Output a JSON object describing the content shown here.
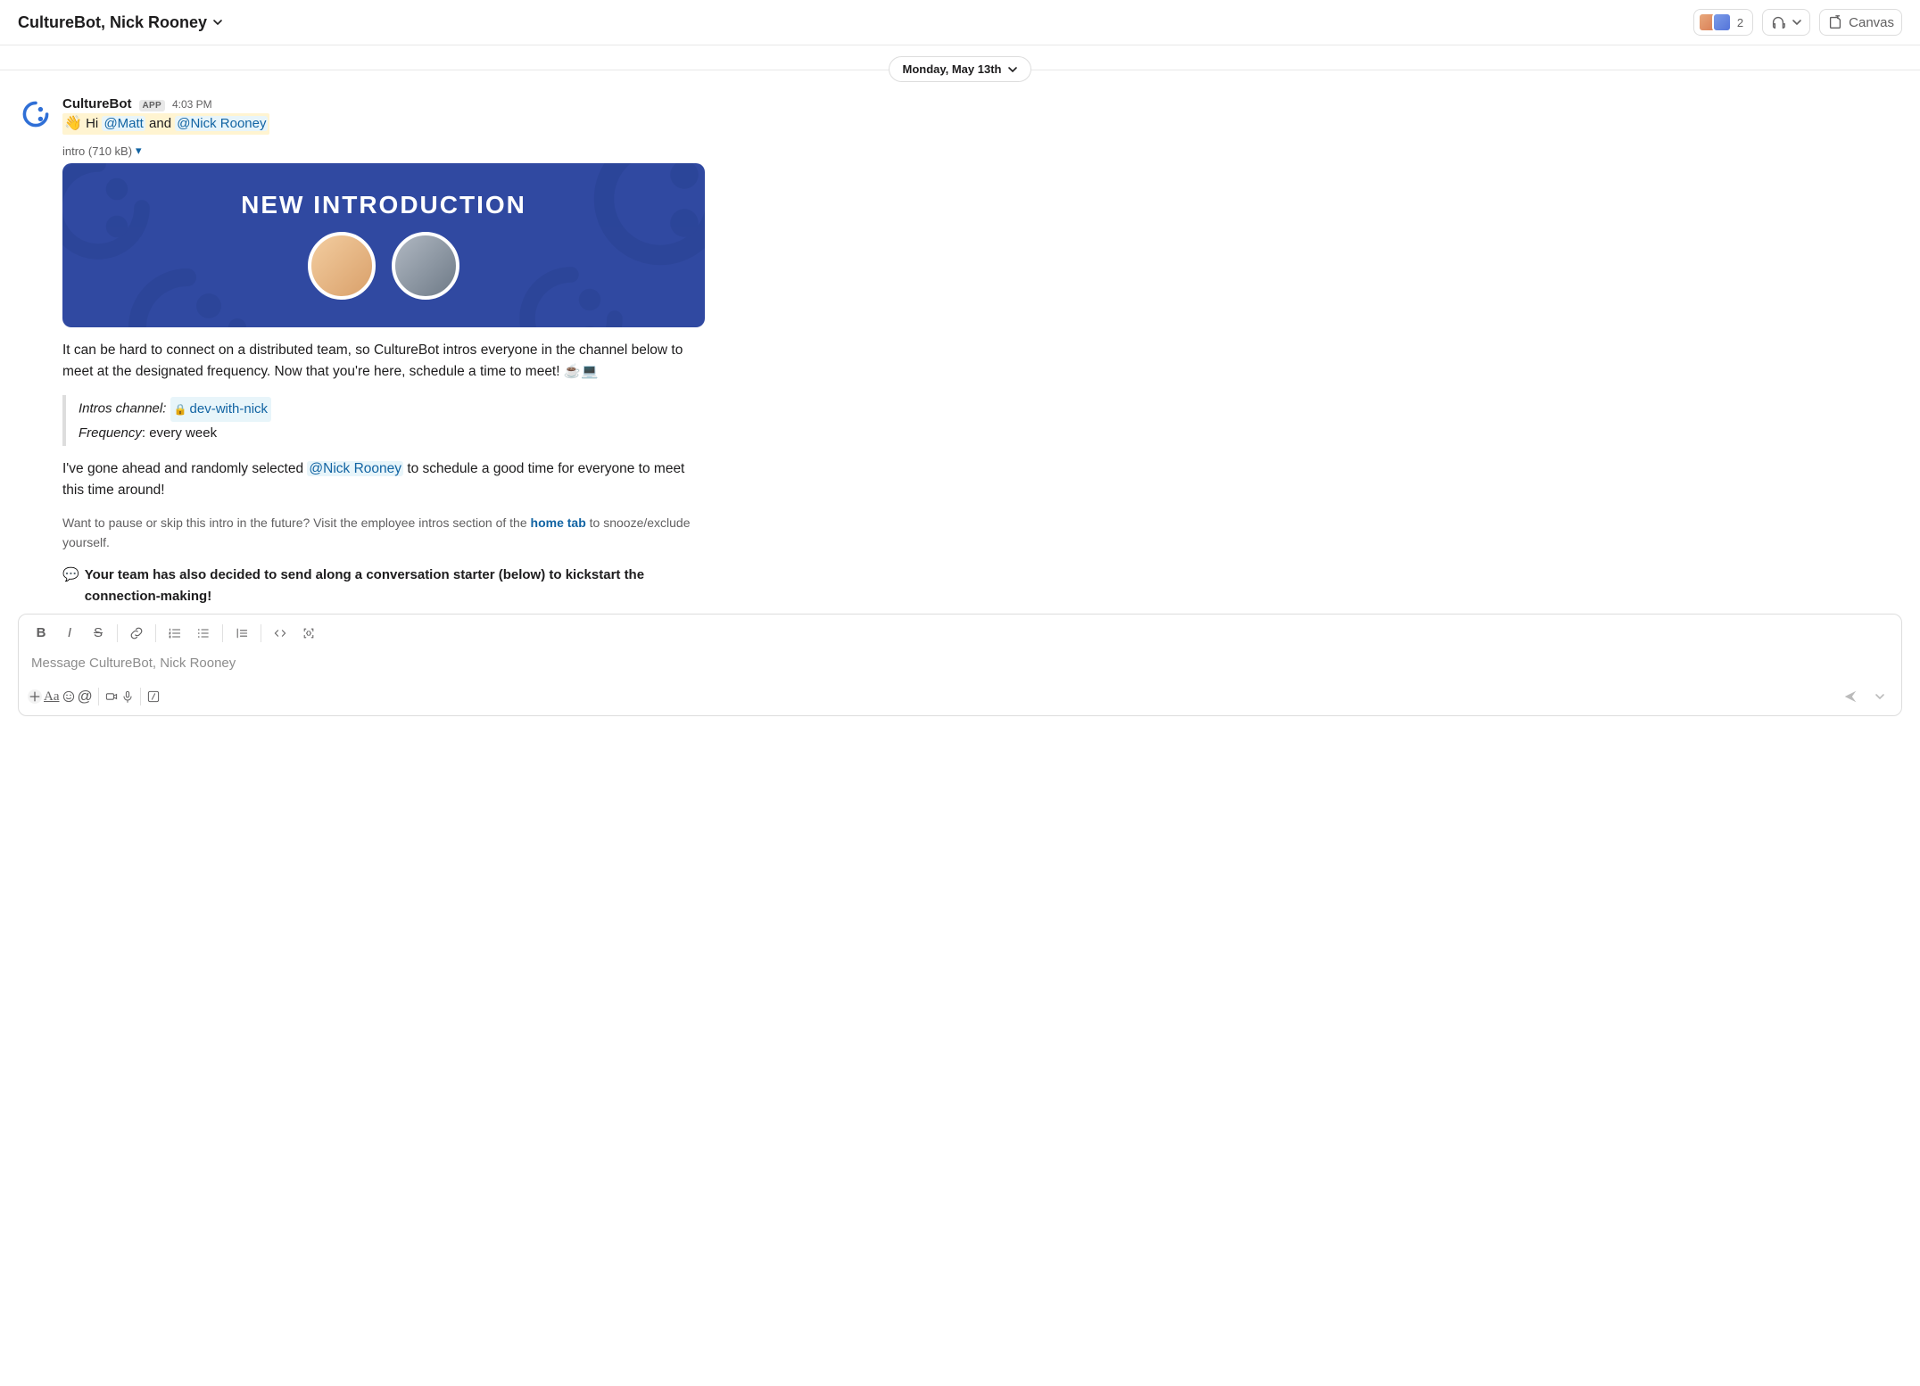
{
  "header": {
    "title": "CultureBot, Nick Rooney",
    "member_count": "2",
    "canvas_label": "Canvas"
  },
  "date_divider": "Monday, May 13th",
  "message": {
    "sender": "CultureBot",
    "app_badge": "APP",
    "time": "4:03 PM",
    "greeting_prefix": "Hi ",
    "mention1": "@Matt",
    "greeting_mid": " and ",
    "mention2": "@Nick Rooney",
    "attachment_label": "intro (710 kB)",
    "card_title": "NEW INTRODUCTION",
    "intro_paragraph": "It can be hard to connect on a distributed team, so CultureBot intros everyone in the channel below to meet at the designated frequency. Now that you're here, schedule a time to meet! ☕💻",
    "channel_label": "Intros channel:",
    "channel_name": "dev-with-nick",
    "frequency_label": "Frequency",
    "frequency_value": ": every week",
    "selected_prefix": "I've gone ahead and randomly selected ",
    "selected_mention": "@Nick Rooney",
    "selected_suffix": " to schedule a good time for everyone to meet this time around!",
    "hint_prefix": "Want to pause or skip this intro in the future? Visit the employee intros section of the ",
    "hint_link": "home tab",
    "hint_suffix": " to snooze/exclude yourself.",
    "convo_starter": "Your team has also decided to send along a conversation starter (below) to kickstart the connection-making!"
  },
  "composer": {
    "placeholder": "Message CultureBot, Nick Rooney"
  }
}
